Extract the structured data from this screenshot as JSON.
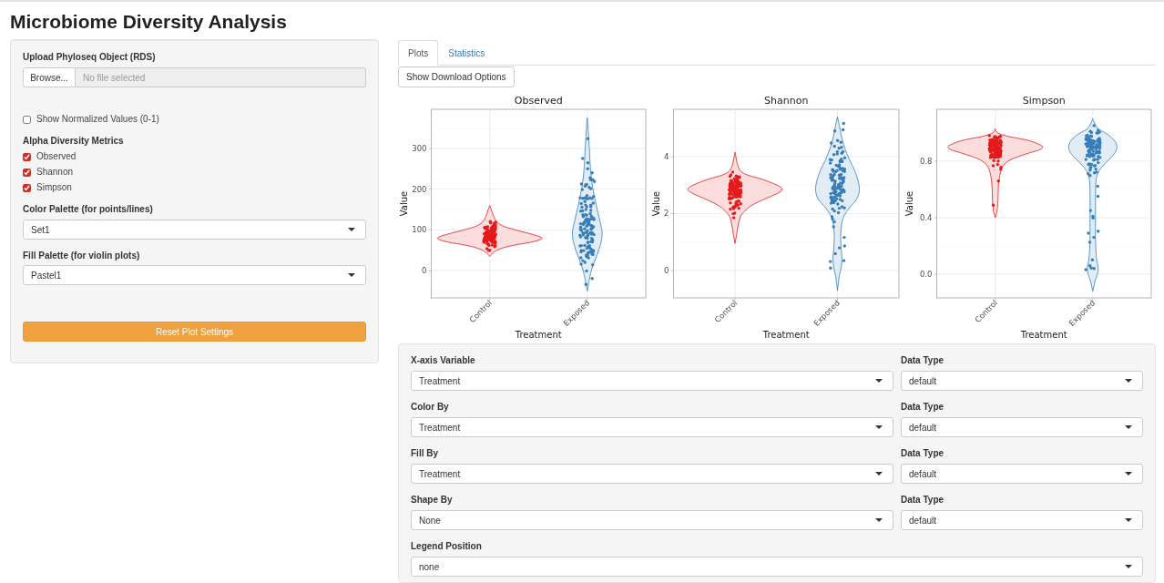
{
  "page": {
    "title": "Microbiome Diversity Analysis"
  },
  "sidebar": {
    "upload": {
      "label": "Upload Phyloseq Object (RDS)",
      "button": "Browse...",
      "placeholder": "No file selected"
    },
    "normalize": {
      "label": "Show Normalized Values (0-1)",
      "checked": false
    },
    "metrics": {
      "label": "Alpha Diversity Metrics",
      "options": [
        {
          "label": "Observed",
          "checked": true
        },
        {
          "label": "Shannon",
          "checked": true
        },
        {
          "label": "Simpson",
          "checked": true
        }
      ]
    },
    "color_palette": {
      "label": "Color Palette (for points/lines)",
      "value": "Set1"
    },
    "fill_palette": {
      "label": "Fill Palette (for violin plots)",
      "value": "Pastel1"
    },
    "reset_button": "Reset Plot Settings"
  },
  "tabs": [
    {
      "label": "Plots",
      "selected": true
    },
    {
      "label": "Statistics",
      "selected": false
    }
  ],
  "download_button": "Show Download Options",
  "plots": [
    {
      "title": "Observed",
      "ylabel": "Value",
      "yticks": [
        "300",
        "200",
        "100",
        "0"
      ],
      "categories": [
        {
          "label": "Control",
          "color": "#e41a1c"
        },
        {
          "label": "Exposed",
          "color": "#377eb8"
        }
      ],
      "xlabel": "Treatment"
    },
    {
      "title": "Shannon",
      "ylabel": "Value",
      "yticks": [
        "4",
        "2",
        "0"
      ],
      "categories": [
        {
          "label": "Control",
          "color": "#e41a1c"
        },
        {
          "label": "Exposed",
          "color": "#377eb8"
        }
      ],
      "xlabel": "Treatment"
    },
    {
      "title": "Simpson",
      "ylabel": "Value",
      "yticks": [
        "0.8",
        "0.4",
        "0.0"
      ],
      "categories": [
        {
          "label": "Control",
          "color": "#e41a1c"
        },
        {
          "label": "Exposed",
          "color": "#377eb8"
        }
      ],
      "xlabel": "Treatment"
    }
  ],
  "settings": {
    "rows": [
      {
        "label": "X-axis Variable",
        "value": "Treatment",
        "type_label": "Data Type",
        "type_value": "default"
      },
      {
        "label": "Color By",
        "value": "Treatment",
        "type_label": "Data Type",
        "type_value": "default"
      },
      {
        "label": "Fill By",
        "value": "Treatment",
        "type_label": "Data Type",
        "type_value": "default"
      },
      {
        "label": "Shape By",
        "value": "None",
        "type_label": "Data Type",
        "type_value": "default"
      },
      {
        "label": "Legend Position",
        "value": "none"
      }
    ]
  }
}
